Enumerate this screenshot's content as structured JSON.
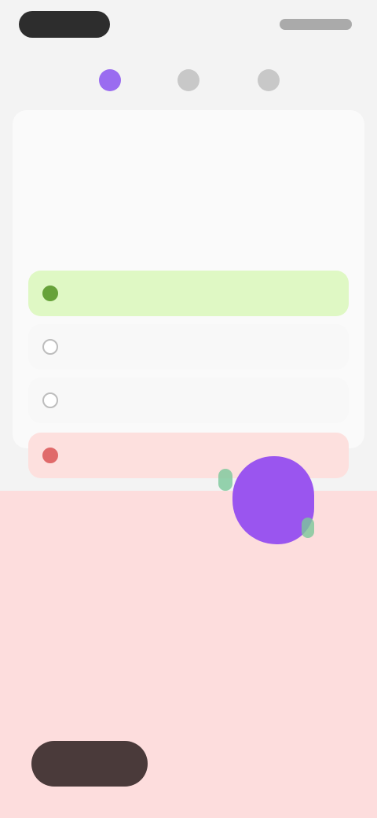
{
  "tabs": [
    {
      "icon": "lesson-icon",
      "active": true
    },
    {
      "icon": "practice-icon",
      "active": false
    },
    {
      "icon": "profile-icon",
      "active": false
    }
  ],
  "quiz": {
    "eyebrow": "",
    "question": "",
    "options": [
      {
        "label": "",
        "state": "correct"
      },
      {
        "label": "",
        "state": "neutral"
      },
      {
        "label": "",
        "state": "neutral"
      },
      {
        "label": "",
        "state": "incorrect"
      }
    ]
  },
  "feedback": {
    "title": "",
    "subtitle": "",
    "body": "",
    "button_label": ""
  },
  "colors": {
    "accent": "#9a6cf0",
    "correct_bg": "#dff8c4",
    "incorrect_bg": "#fde0de",
    "sheet_bg": "#fddddd"
  }
}
